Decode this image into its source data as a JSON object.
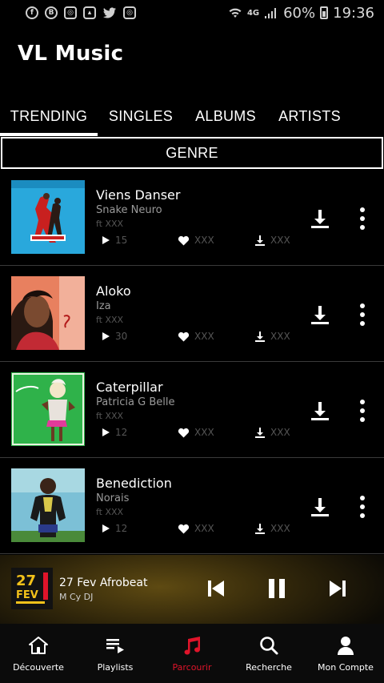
{
  "status_bar": {
    "battery": "60%",
    "time": "19:36",
    "network": "4G"
  },
  "app": {
    "title": "VL Music"
  },
  "tabs": [
    {
      "label": "TRENDING",
      "active": true
    },
    {
      "label": "SINGLES",
      "active": false
    },
    {
      "label": "ALBUMS",
      "active": false
    },
    {
      "label": "ARTISTS",
      "active": false
    }
  ],
  "genre_button": "GENRE",
  "tracks": [
    {
      "title": "Viens Danser",
      "artist": "Snake Neuro",
      "ft": "ft XXX",
      "plays": "15",
      "likes": "XXX",
      "downloads": "XXX",
      "cover_icon": "dancers-cover"
    },
    {
      "title": "Aloko",
      "artist": "Iza",
      "ft": "ft XXX",
      "plays": "30",
      "likes": "XXX",
      "downloads": "XXX",
      "cover_icon": "portrait-cover"
    },
    {
      "title": "Caterpillar",
      "artist": "Patricia G Belle",
      "ft": "ft XXX",
      "plays": "12",
      "likes": "XXX",
      "downloads": "XXX",
      "cover_icon": "singer-cover"
    },
    {
      "title": "Benediction",
      "artist": "Norais",
      "ft": "ft XXX",
      "plays": "12",
      "likes": "XXX",
      "downloads": "XXX",
      "cover_icon": "artist-cover"
    }
  ],
  "player": {
    "title": "27 Fev Afrobeat",
    "artist": "M Cy DJ",
    "art_text": "27 FEV"
  },
  "bottom_nav": [
    {
      "label": "Découverte",
      "icon": "home-icon",
      "active": false
    },
    {
      "label": "Playlists",
      "icon": "playlist-icon",
      "active": false
    },
    {
      "label": "Parcourir",
      "icon": "music-note-icon",
      "active": true
    },
    {
      "label": "Recherche",
      "icon": "search-icon",
      "active": false
    },
    {
      "label": "Mon Compte",
      "icon": "account-icon",
      "active": false
    }
  ],
  "colors": {
    "background": "#000000",
    "accent": "#e0142a",
    "muted_text": "#9a9a9a",
    "divider": "#3a3a3a"
  }
}
